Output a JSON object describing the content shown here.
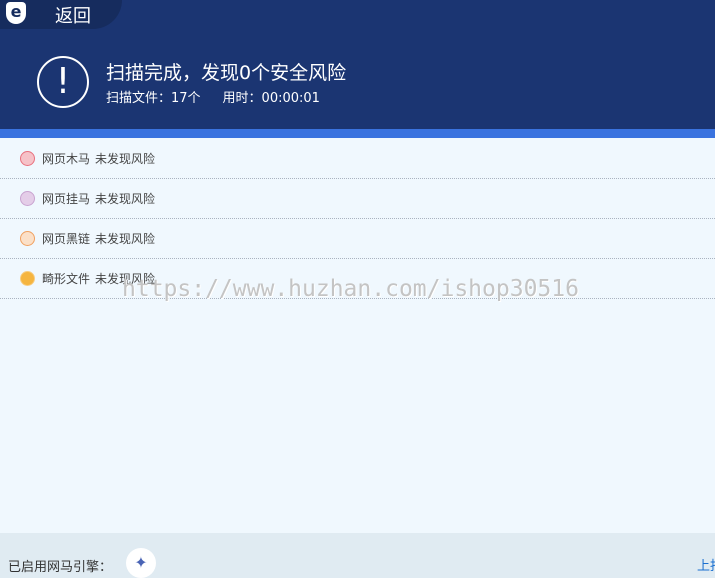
{
  "header": {
    "back_label": "返回",
    "logo_letter": "e",
    "title": "扫描完成，发现0个安全风险",
    "files": "扫描文件：17个",
    "time": "用时：00:00:01"
  },
  "items": [
    {
      "name": "网页木马",
      "status": "未发现风险",
      "color": "#e8707e"
    },
    {
      "name": "网页挂马",
      "status": "未发现风险",
      "color": "#b97fc0"
    },
    {
      "name": "网页黑链",
      "status": "未发现风险",
      "color": "#f0a060"
    },
    {
      "name": "畸形文件",
      "status": "未发现风险",
      "color": "#f5b540"
    }
  ],
  "watermark": "https://www.huzhan.com/ishop30516",
  "footer": {
    "engine_label": "已启用网马引擎：",
    "link": "上报"
  }
}
